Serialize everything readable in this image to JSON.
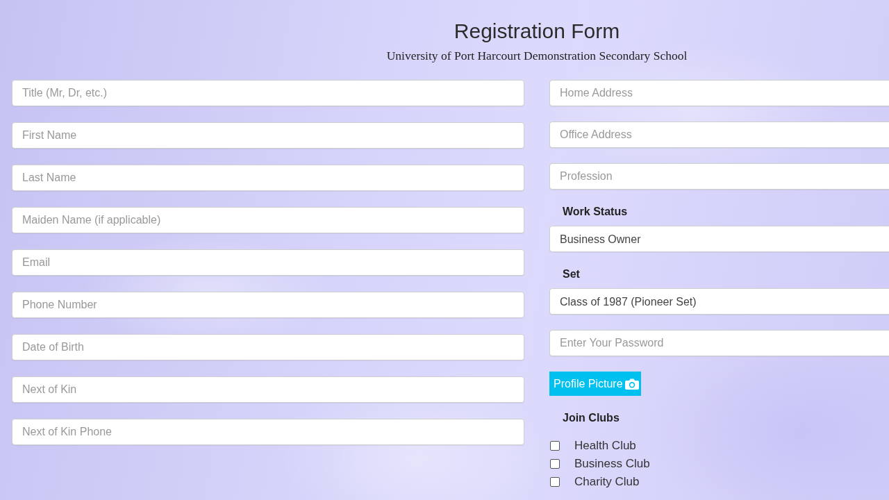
{
  "header": {
    "title": "Registration Form",
    "subtitle": "University of Port Harcourt Demonstration Secondary School"
  },
  "left_fields": [
    {
      "placeholder": "Title (Mr, Dr, etc.)"
    },
    {
      "placeholder": "First Name"
    },
    {
      "placeholder": "Last Name"
    },
    {
      "placeholder": "Maiden Name (if applicable)"
    },
    {
      "placeholder": "Email"
    },
    {
      "placeholder": "Phone Number"
    },
    {
      "placeholder": "Date of Birth"
    },
    {
      "placeholder": "Next of Kin"
    },
    {
      "placeholder": "Next of Kin Phone"
    }
  ],
  "right_fields": [
    {
      "kind": "text",
      "placeholder": "Home Address"
    },
    {
      "kind": "text",
      "placeholder": "Office Address"
    },
    {
      "kind": "text",
      "placeholder": "Profession"
    },
    {
      "kind": "select",
      "label": "Work Status",
      "value": "Business Owner"
    },
    {
      "kind": "select",
      "label": "Set",
      "value": "Class of 1987 (Pioneer Set)"
    },
    {
      "kind": "password",
      "placeholder": "Enter Your Password"
    },
    {
      "kind": "upload",
      "label": "Profile Picture"
    },
    {
      "kind": "checkboxes",
      "label": "Join Clubs",
      "options": [
        {
          "label": "Health Club",
          "checked": false
        },
        {
          "label": "Business Club",
          "checked": false
        },
        {
          "label": "Charity Club",
          "checked": false
        }
      ]
    }
  ]
}
